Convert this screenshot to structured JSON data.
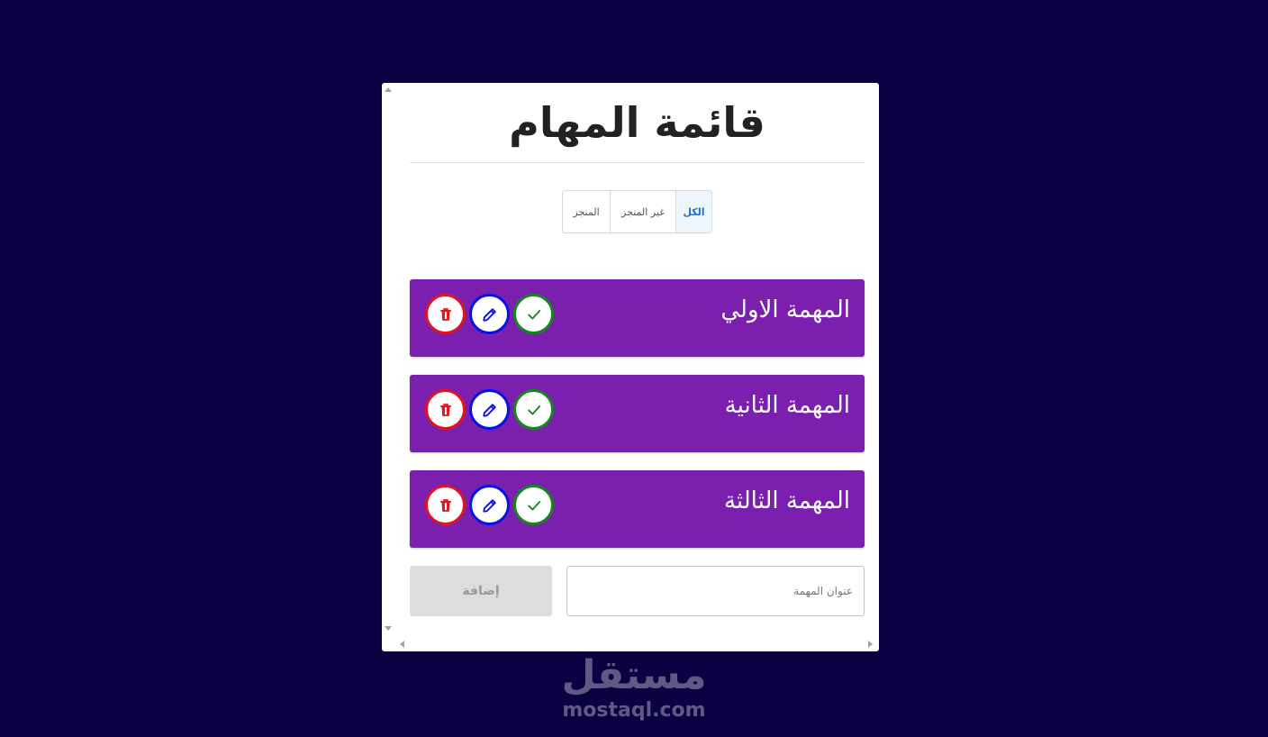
{
  "app": {
    "title": "قائمة المهام"
  },
  "filters": {
    "all": "الكل",
    "undone": "غير المنجز",
    "done": "المنجز",
    "selected": "الكل"
  },
  "tasks": [
    {
      "title": "المهمة الاولي"
    },
    {
      "title": "المهمة الثانية"
    },
    {
      "title": "المهمة الثالثة"
    }
  ],
  "add_form": {
    "input_value": "",
    "input_placeholder": "عنوان المهمة",
    "add_label": "إضافة"
  },
  "icons": {
    "done": "check-icon",
    "edit": "pencil-icon",
    "delete": "trash-icon"
  },
  "colors": {
    "background": "#0b0041",
    "task_bg": "#7b1fae",
    "done": "#128a1b",
    "edit": "#0a10e8",
    "delete": "#e0141e",
    "active_tab": "#1f6fc2"
  },
  "watermark": {
    "arabic": "مستقل",
    "latin": "mostaql.com"
  }
}
